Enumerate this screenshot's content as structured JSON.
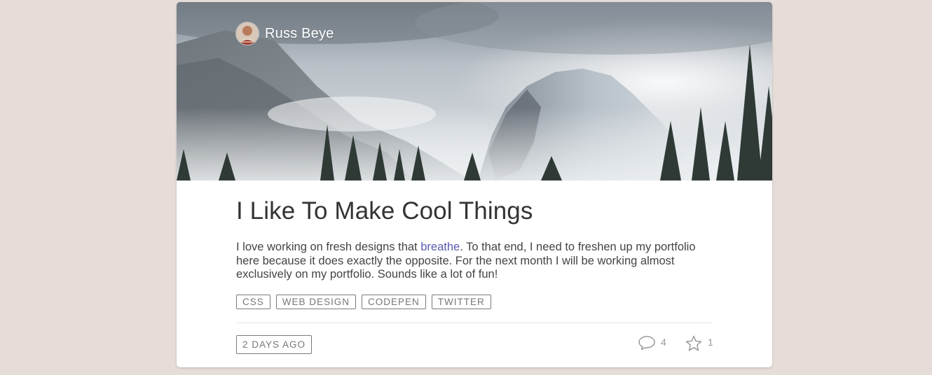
{
  "author": {
    "name": "Russ Beye"
  },
  "post": {
    "title": "I Like To Make Cool Things",
    "body_before": "I love working on fresh designs that ",
    "body_link": "breathe",
    "body_after": ". To that end, I need to freshen up my portfolio here because it does exactly the opposite. For the next month I will be working almost exclusively on my portfolio. Sounds like a lot of fun!",
    "tags": [
      "CSS",
      "WEB DESIGN",
      "CODEPEN",
      "TWITTER"
    ],
    "posted": "2 DAYS AGO"
  },
  "stats": {
    "comments": "4",
    "stars": "1"
  },
  "icons": {
    "comments": "speech-bubble-icon",
    "stars": "star-icon"
  },
  "colors": {
    "background": "#e6ddd8",
    "link": "#5a5bb0",
    "card": "#ffffff"
  }
}
